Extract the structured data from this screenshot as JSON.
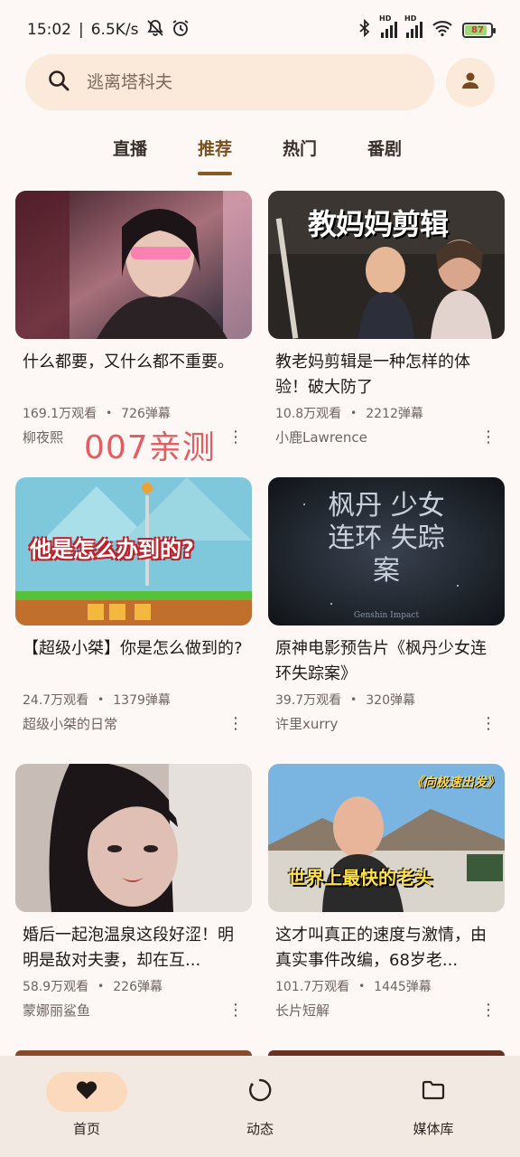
{
  "status_bar": {
    "time": "15:02",
    "network_speed": "6.5K/s",
    "battery": "87",
    "battery_level": 0.87,
    "hd1": "HD",
    "hd2": "HD"
  },
  "search": {
    "placeholder": "逃离塔科夫"
  },
  "tabs": [
    {
      "label": "直播",
      "active": false
    },
    {
      "label": "推荐",
      "active": true
    },
    {
      "label": "热门",
      "active": false
    },
    {
      "label": "番剧",
      "active": false
    }
  ],
  "videos": [
    {
      "title": "什么都要，又什么都不重要。",
      "views": "169.1万观看",
      "danmaku": "726弹幕",
      "author": "柳夜熙"
    },
    {
      "title": "教老妈剪辑是一种怎样的体验！破大防了",
      "views": "10.8万观看",
      "danmaku": "2212弹幕",
      "author": "小鹿Lawrence",
      "thumb_text": "教妈妈剪辑"
    },
    {
      "title": "【超级小桀】你是怎么做到的?",
      "views": "24.7万观看",
      "danmaku": "1379弹幕",
      "author": "超级小桀的日常",
      "thumb_text": "他是怎么办到的?"
    },
    {
      "title": "原神电影预告片《枫丹少女连环失踪案》",
      "views": "39.7万观看",
      "danmaku": "320弹幕",
      "author": "许里xurry",
      "thumb_text": "枫丹 少女连环 失踪案",
      "thumb_subtext": "Genshin Impact"
    },
    {
      "title": "婚后一起泡温泉这段好涩！明明是敌对夫妻，却在互...",
      "views": "58.9万观看",
      "danmaku": "226弹幕",
      "author": "蒙娜丽鲨鱼"
    },
    {
      "title": "这才叫真正的速度与激情，由真实事件改编，68岁老...",
      "views": "101.7万观看",
      "danmaku": "1445弹幕",
      "author": "长片短解",
      "thumb_text": "世界上最快的老头",
      "thumb_tag": "《向极速出发》"
    }
  ],
  "overlay_text": "007亲测",
  "bottom_nav": [
    {
      "label": "首页",
      "icon": "heart-icon",
      "active": true
    },
    {
      "label": "动态",
      "icon": "refresh-circle-icon",
      "active": false
    },
    {
      "label": "媒体库",
      "icon": "folder-icon",
      "active": false
    }
  ],
  "colors": {
    "accent": "#8a5a22",
    "search_bg": "#fbe9da",
    "nav_bg": "#f3e9e3",
    "active_pill": "#fbd9bd",
    "overlay": "#e35d62"
  }
}
